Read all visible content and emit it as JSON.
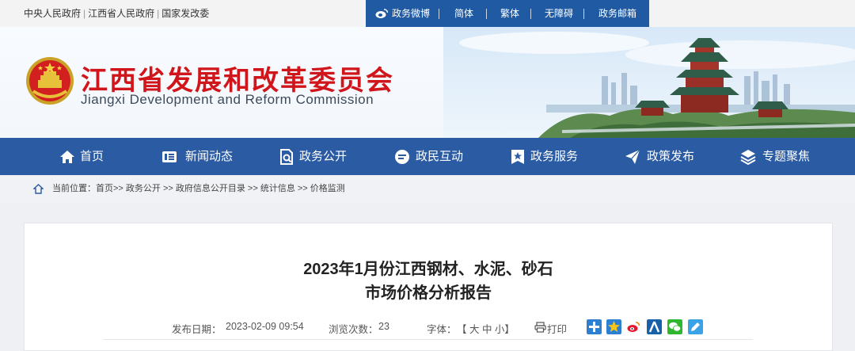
{
  "top_links": [
    "中央人民政府",
    "江西省人民政府",
    "国家发改委"
  ],
  "top_menu": {
    "weibo": "政务微博",
    "simplified": "简体",
    "traditional": "繁体",
    "accessible": "无障碍",
    "mailbox": "政务邮箱"
  },
  "site": {
    "title": "江西省发展和改革委员会",
    "subtitle": "Jiangxi Development and Reform Commission"
  },
  "nav": [
    "首页",
    "新闻动态",
    "政务公开",
    "政民互动",
    "政务服务",
    "政策发布",
    "专题聚焦"
  ],
  "breadcrumb": {
    "prefix": "当前位置：",
    "path": "首页>> 政务公开 >> 政府信息公开目录 >> 统计信息 >> 价格监测"
  },
  "article": {
    "title_line1": "2023年1月份江西钢材、水泥、砂石",
    "title_line2": "市场价格分析报告",
    "date_label": "发布日期：",
    "date_value": "2023-02-09 09:54",
    "views_label": "浏览次数：",
    "views_value": "23",
    "font_label": "字体：",
    "font_options": "【 大 中 小】",
    "print_label": "打印"
  },
  "colors": {
    "nav_bg": "#2a5ba3",
    "title_red": "#d1161b"
  }
}
